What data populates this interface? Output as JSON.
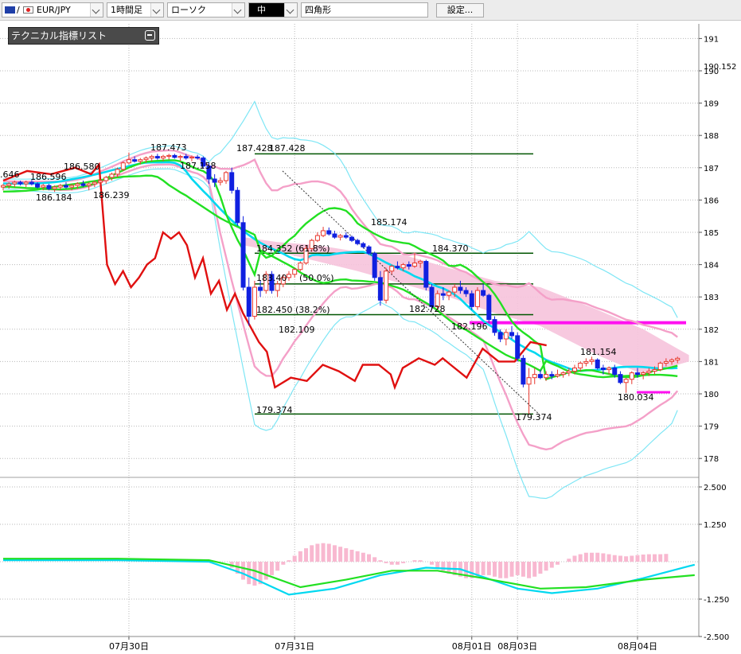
{
  "toolbar": {
    "symbol": "EUR/JPY",
    "timeframe": "1時間足",
    "chart_type": "ローソク",
    "line_style": "中",
    "shape": "四角形",
    "settings": "設定..."
  },
  "indicator_panel": {
    "title": "テクニカル指標リスト"
  },
  "colors": {
    "candle_up": "#e8372e",
    "candle_down": "#1020e0",
    "bollinger_outer": "#7ee6f5",
    "bollinger_inner": "#f4a0c8",
    "moving_average_fast": "#00d8f0",
    "moving_average_slow": "#22e022",
    "red_line": "#e01010",
    "cloud_fill": "#f6c3dc",
    "level_line": "#005500",
    "magenta_level": "#ff10f0",
    "macd_hist": "#f8b8d0"
  },
  "chart_data": {
    "type": "candlestick",
    "price_axis": {
      "ticks": [
        191,
        190,
        189,
        188,
        187,
        186,
        185,
        184,
        183,
        182,
        181,
        180,
        179,
        178
      ],
      "current_price_label": "190.152",
      "current_price": 190.152,
      "range": [
        177.45,
        191.3
      ]
    },
    "macd_axis": {
      "ticks": [
        "2.500",
        "1.250",
        "-1.250",
        "-2.500"
      ],
      "values": [
        2.5,
        1.25,
        -1.25,
        -2.5
      ]
    },
    "date_labels": [
      "07月30日",
      "07月31日",
      "08月01日",
      "08月03日",
      "08月04日"
    ],
    "price_labels": [
      "187.473",
      "187.158",
      "187.428",
      "187.428",
      "186.596",
      "186.580",
      "186.184",
      "186.239",
      "185.174",
      "184.370",
      "182.728",
      "182.109",
      "182.196",
      "181.154",
      "180.034",
      "179.374",
      ".646"
    ],
    "fibonacci_levels": [
      {
        "label": "184.352 (61.8%)",
        "price": 184.352
      },
      {
        "label": "183.40",
        "pct": "(50.0%)",
        "price": 183.401
      },
      {
        "label": "182.450 (38.2%)",
        "price": 182.45
      },
      {
        "label": "179.374",
        "price": 179.374
      }
    ],
    "top_level": 187.428,
    "magenta_level": 182.2,
    "candles": [
      [
        186.4,
        186.5,
        186.3,
        186.45
      ],
      [
        186.45,
        186.55,
        186.35,
        186.5
      ],
      [
        186.5,
        186.6,
        186.4,
        186.55
      ],
      [
        186.55,
        186.6,
        186.45,
        186.5
      ],
      [
        186.5,
        186.6,
        186.4,
        186.55
      ],
      [
        186.55,
        186.62,
        186.45,
        186.5
      ],
      [
        186.5,
        186.55,
        186.35,
        186.4
      ],
      [
        186.4,
        186.5,
        186.3,
        186.45
      ],
      [
        186.45,
        186.5,
        186.3,
        186.35
      ],
      [
        186.35,
        186.45,
        186.25,
        186.4
      ],
      [
        186.4,
        186.5,
        186.3,
        186.45
      ],
      [
        186.45,
        186.55,
        186.35,
        186.4
      ],
      [
        186.4,
        186.5,
        186.3,
        186.45
      ],
      [
        186.45,
        186.55,
        186.35,
        186.5
      ],
      [
        186.5,
        186.6,
        186.4,
        186.45
      ],
      [
        186.45,
        186.55,
        186.3,
        186.5
      ],
      [
        186.5,
        186.6,
        186.4,
        186.55
      ],
      [
        186.55,
        186.65,
        186.45,
        186.6
      ],
      [
        186.6,
        186.75,
        186.5,
        186.7
      ],
      [
        186.7,
        186.85,
        186.6,
        186.8
      ],
      [
        186.8,
        187.0,
        186.7,
        186.95
      ],
      [
        186.95,
        187.2,
        186.9,
        187.15
      ],
      [
        187.15,
        187.47,
        187.1,
        187.25
      ],
      [
        187.25,
        187.35,
        187.16,
        187.2
      ],
      [
        187.2,
        187.3,
        187.1,
        187.25
      ],
      [
        187.25,
        187.35,
        187.15,
        187.3
      ],
      [
        187.3,
        187.4,
        187.2,
        187.35
      ],
      [
        187.35,
        187.43,
        187.25,
        187.3
      ],
      [
        187.3,
        187.4,
        187.2,
        187.35
      ],
      [
        187.35,
        187.43,
        187.25,
        187.38
      ],
      [
        187.38,
        187.43,
        187.28,
        187.32
      ],
      [
        187.32,
        187.4,
        187.2,
        187.35
      ],
      [
        187.35,
        187.43,
        187.25,
        187.3
      ],
      [
        187.3,
        187.38,
        187.2,
        187.33
      ],
      [
        187.33,
        187.4,
        187.25,
        187.3
      ],
      [
        187.3,
        187.35,
        187.0,
        187.05
      ],
      [
        187.05,
        187.15,
        186.5,
        186.65
      ],
      [
        186.65,
        186.8,
        186.4,
        186.55
      ],
      [
        186.55,
        186.7,
        186.45,
        186.6
      ],
      [
        186.6,
        186.9,
        186.5,
        186.85
      ],
      [
        186.85,
        187.0,
        186.2,
        186.3
      ],
      [
        186.3,
        186.4,
        185.2,
        185.3
      ],
      [
        185.3,
        185.5,
        183.2,
        183.3
      ],
      [
        183.3,
        183.6,
        182.11,
        182.4
      ],
      [
        182.4,
        183.5,
        182.3,
        183.3
      ],
      [
        183.3,
        183.5,
        183.0,
        183.2
      ],
      [
        183.2,
        183.8,
        183.1,
        183.7
      ],
      [
        183.7,
        183.8,
        183.1,
        183.2
      ],
      [
        183.2,
        183.5,
        183.0,
        183.4
      ],
      [
        183.4,
        183.7,
        183.3,
        183.6
      ],
      [
        183.6,
        183.8,
        183.5,
        183.7
      ],
      [
        183.7,
        183.9,
        183.6,
        183.85
      ],
      [
        183.85,
        184.1,
        183.8,
        184.05
      ],
      [
        184.05,
        184.6,
        184.0,
        184.5
      ],
      [
        184.5,
        184.8,
        184.4,
        184.75
      ],
      [
        184.75,
        185.0,
        184.7,
        184.9
      ],
      [
        184.9,
        185.17,
        184.85,
        185.05
      ],
      [
        185.05,
        185.15,
        184.9,
        184.95
      ],
      [
        184.95,
        185.05,
        184.8,
        184.85
      ],
      [
        184.85,
        184.95,
        184.75,
        184.9
      ],
      [
        184.9,
        185.0,
        184.8,
        184.85
      ],
      [
        184.85,
        184.9,
        184.7,
        184.75
      ],
      [
        184.75,
        184.8,
        184.6,
        184.65
      ],
      [
        184.65,
        184.7,
        184.5,
        184.55
      ],
      [
        184.55,
        184.6,
        184.3,
        184.35
      ],
      [
        184.35,
        184.4,
        183.5,
        183.6
      ],
      [
        183.6,
        183.8,
        182.73,
        182.9
      ],
      [
        182.9,
        183.9,
        182.8,
        183.8
      ],
      [
        183.8,
        184.0,
        183.7,
        183.95
      ],
      [
        183.95,
        184.1,
        183.85,
        183.9
      ],
      [
        183.9,
        184.05,
        183.8,
        184.0
      ],
      [
        184.0,
        184.1,
        183.85,
        183.95
      ],
      [
        183.95,
        184.37,
        183.9,
        184.05
      ],
      [
        184.05,
        184.15,
        183.9,
        184.1
      ],
      [
        184.1,
        184.15,
        183.2,
        183.3
      ],
      [
        183.3,
        183.4,
        182.6,
        182.7
      ],
      [
        182.7,
        183.2,
        182.6,
        183.1
      ],
      [
        183.1,
        183.3,
        182.9,
        183.05
      ],
      [
        183.05,
        183.2,
        182.9,
        183.15
      ],
      [
        183.15,
        183.4,
        183.0,
        183.3
      ],
      [
        183.3,
        183.5,
        183.1,
        183.2
      ],
      [
        183.2,
        183.3,
        183.0,
        183.1
      ],
      [
        183.1,
        183.2,
        182.6,
        182.7
      ],
      [
        182.7,
        183.3,
        182.6,
        183.2
      ],
      [
        183.2,
        183.4,
        183.0,
        183.05
      ],
      [
        183.05,
        183.1,
        182.2,
        182.3
      ],
      [
        182.3,
        182.4,
        181.8,
        181.9
      ],
      [
        181.9,
        182.0,
        181.6,
        181.7
      ],
      [
        181.7,
        182.0,
        181.5,
        181.9
      ],
      [
        181.9,
        182.1,
        181.7,
        181.8
      ],
      [
        181.8,
        181.9,
        181.0,
        181.1
      ],
      [
        181.1,
        181.2,
        180.2,
        180.3
      ],
      [
        180.3,
        180.8,
        179.37,
        180.5
      ],
      [
        180.5,
        180.8,
        180.3,
        180.6
      ],
      [
        180.6,
        180.75,
        180.45,
        180.5
      ],
      [
        180.5,
        180.7,
        180.4,
        180.6
      ],
      [
        180.6,
        180.7,
        180.45,
        180.55
      ],
      [
        180.55,
        180.75,
        180.5,
        180.6
      ],
      [
        180.6,
        180.7,
        180.5,
        180.65
      ],
      [
        180.65,
        180.8,
        180.55,
        180.7
      ],
      [
        180.7,
        180.9,
        180.6,
        180.8
      ],
      [
        180.8,
        181.0,
        180.7,
        180.95
      ],
      [
        180.95,
        181.1,
        180.85,
        181.0
      ],
      [
        181.0,
        181.15,
        180.9,
        181.05
      ],
      [
        181.05,
        181.1,
        180.75,
        180.8
      ],
      [
        180.8,
        180.9,
        180.6,
        180.75
      ],
      [
        180.75,
        180.85,
        180.6,
        180.8
      ],
      [
        180.8,
        180.9,
        180.5,
        180.6
      ],
      [
        180.6,
        180.7,
        180.3,
        180.35
      ],
      [
        180.35,
        180.5,
        180.03,
        180.45
      ],
      [
        180.45,
        180.7,
        180.3,
        180.65
      ],
      [
        180.65,
        180.8,
        180.5,
        180.6
      ],
      [
        180.6,
        180.7,
        180.45,
        180.65
      ],
      [
        180.65,
        180.8,
        180.55,
        180.7
      ],
      [
        180.7,
        180.85,
        180.6,
        180.75
      ],
      [
        180.75,
        181.0,
        180.7,
        180.95
      ],
      [
        180.95,
        181.1,
        180.85,
        181.0
      ],
      [
        181.0,
        181.1,
        180.9,
        181.05
      ],
      [
        181.05,
        181.15,
        180.95,
        181.1
      ]
    ],
    "macd_hist": [
      0,
      0,
      0,
      0,
      0,
      0,
      0,
      0,
      0,
      0,
      0,
      0,
      0,
      0,
      0,
      0,
      0,
      0,
      0,
      0,
      0,
      0,
      0,
      0,
      0,
      0,
      0,
      0,
      0,
      0,
      0,
      0,
      0,
      0,
      0,
      0,
      0,
      0,
      0,
      0,
      -0.2,
      -0.4,
      -0.6,
      -0.75,
      -0.8,
      -0.75,
      -0.6,
      -0.45,
      -0.3,
      -0.1,
      0.05,
      0.2,
      0.35,
      0.45,
      0.55,
      0.6,
      0.62,
      0.6,
      0.55,
      0.5,
      0.45,
      0.4,
      0.35,
      0.3,
      0.25,
      0.15,
      0.05,
      -0.05,
      -0.1,
      -0.1,
      -0.05,
      0,
      0.05,
      0.05,
      0,
      -0.1,
      -0.2,
      -0.3,
      -0.4,
      -0.45,
      -0.5,
      -0.55,
      -0.55,
      -0.5,
      -0.45,
      -0.45,
      -0.5,
      -0.55,
      -0.55,
      -0.5,
      -0.45,
      -0.5,
      -0.55,
      -0.5,
      -0.4,
      -0.3,
      -0.2,
      -0.1,
      0,
      0.1,
      0.2,
      0.25,
      0.3,
      0.3,
      0.3,
      0.28,
      0.25,
      0.22,
      0.2,
      0.18,
      0.2,
      0.22,
      0.24,
      0.25,
      0.25,
      0.25,
      0.26
    ]
  }
}
